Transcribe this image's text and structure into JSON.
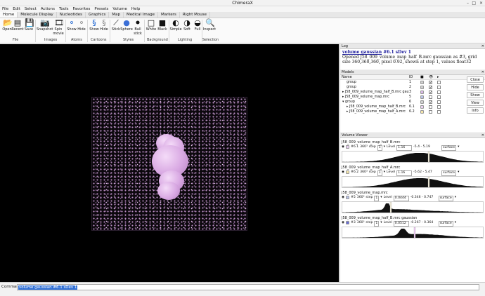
{
  "window": {
    "title": "ChimeraX",
    "controls": [
      "–",
      "□",
      "×"
    ]
  },
  "menu": [
    "File",
    "Edit",
    "Select",
    "Actions",
    "Tools",
    "Favorites",
    "Presets",
    "Volume",
    "Help"
  ],
  "tabs": [
    "Home",
    "Molecule Display",
    "Nucleotides",
    "Graphics",
    "Map",
    "Medical Image",
    "Markers",
    "Right Mouse"
  ],
  "toolbar": {
    "tools": [
      {
        "label": "Open",
        "icon": "folder-open-icon",
        "glyph": "📂"
      },
      {
        "label": "Recent",
        "icon": "recent-icon",
        "glyph": "▤"
      },
      {
        "label": "Save",
        "icon": "save-icon",
        "glyph": "💾"
      },
      {
        "label": "Snapshot",
        "icon": "camera-icon",
        "glyph": "📷"
      },
      {
        "label": "Spin movie",
        "icon": "movie-icon",
        "glyph": "🎞"
      },
      {
        "label": "Show",
        "icon": "show-atoms-icon",
        "glyph": "⚬"
      },
      {
        "label": "Hide",
        "icon": "hide-atoms-icon",
        "glyph": "⚬"
      },
      {
        "label": "Show",
        "icon": "show-cartoon-icon",
        "glyph": "§"
      },
      {
        "label": "Hide",
        "icon": "hide-cartoon-icon",
        "glyph": "§"
      },
      {
        "label": "Stick",
        "icon": "stick-icon",
        "glyph": "⟋"
      },
      {
        "label": "Sphere",
        "icon": "sphere-icon",
        "glyph": "●"
      },
      {
        "label": "Ball stick",
        "icon": "ball-stick-icon",
        "glyph": "⚫"
      },
      {
        "label": "White",
        "icon": "white-background-icon",
        "glyph": "□"
      },
      {
        "label": "Black",
        "icon": "black-background-icon",
        "glyph": "■"
      },
      {
        "label": "Simple",
        "icon": "simple-lighting-icon",
        "glyph": "◐"
      },
      {
        "label": "Soft",
        "icon": "soft-lighting-icon",
        "glyph": "◑"
      },
      {
        "label": "Full",
        "icon": "full-lighting-icon",
        "glyph": "◒"
      },
      {
        "label": "Inspect",
        "icon": "inspect-icon",
        "glyph": "🔍"
      }
    ],
    "groups": [
      "File",
      "Images",
      "Atoms",
      "Cartoons",
      "Styles",
      "Background",
      "Lighting",
      "Selection"
    ]
  },
  "log": {
    "title": "Log",
    "heading": "volume gaussian",
    "heading_rest": " #6.1 sDev 1",
    "lines": [
      "Opened J58_009_volume_map_half_B.mrc gaussian as #3, grid",
      "size 360,360,360, pixel 0.92, shown at step 1, values float32"
    ]
  },
  "models": {
    "title": "Models",
    "columns": [
      "Name",
      "ID"
    ],
    "rows": [
      {
        "name": "group",
        "id": "1",
        "color": "#cfcfcf",
        "checked": true
      },
      {
        "name": "group",
        "id": "2",
        "color": "#cfcfcf",
        "checked": true
      },
      {
        "name": "J58_009_volume_map_half_B.mrc gaussian",
        "id": "3",
        "color": "#d8b7e6",
        "checked": true
      },
      {
        "name": "J58_009_volume_map.mrc",
        "id": "5",
        "color": "#b9c2e6",
        "checked": false
      },
      {
        "name": "group",
        "id": "6",
        "color": "#cfcfcf",
        "checked": true
      },
      {
        "name": "J58_009_volume_map_half_B.mrc",
        "id": "6.1",
        "color": "#e9d0f0",
        "checked": false
      },
      {
        "name": "J58_009_volume_map_half_A.mrc",
        "id": "6.2",
        "color": "#f2e3a8",
        "checked": false
      }
    ],
    "buttons": [
      "Close",
      "Hide",
      "Show",
      "View",
      "Info"
    ]
  },
  "volume_viewer": {
    "title": "Volume Viewer",
    "panels": [
      {
        "name": "J58_009_volume_map_half_B.mrc",
        "id": "#6.1",
        "size": "360³",
        "step": "1",
        "level_label": "Level",
        "level": "1.16",
        "range": "-5.4 - 5.19",
        "style": "surface",
        "color": "#e9d0f0"
      },
      {
        "name": "J58_009_volume_map_half_A.mrc",
        "id": "#6.2",
        "size": "360³",
        "step": "1",
        "level_label": "Level",
        "level": "1.16",
        "range": "-5.62 - 5.47",
        "style": "surface",
        "color": "#f2e3a8"
      },
      {
        "name": "J58_009_volume_map.mrc",
        "id": "#5",
        "size": "360³",
        "step": "1",
        "level_label": "Level",
        "level": "0.0444",
        "range": "-0.346 - 0.747",
        "style": "surface",
        "color": "#b9c2e6"
      },
      {
        "name": "J58_009_volume_map_half_B.mrc gaussian",
        "id": "#3",
        "size": "360³",
        "step": "1",
        "level_label": "Level",
        "level": "0.0512",
        "range": "-0.267 - 0.364",
        "style": "surface",
        "color": "#6a6fd8"
      }
    ]
  },
  "command": {
    "label": "Command:",
    "value": "volume gaussian #6.1 sDev 1"
  }
}
